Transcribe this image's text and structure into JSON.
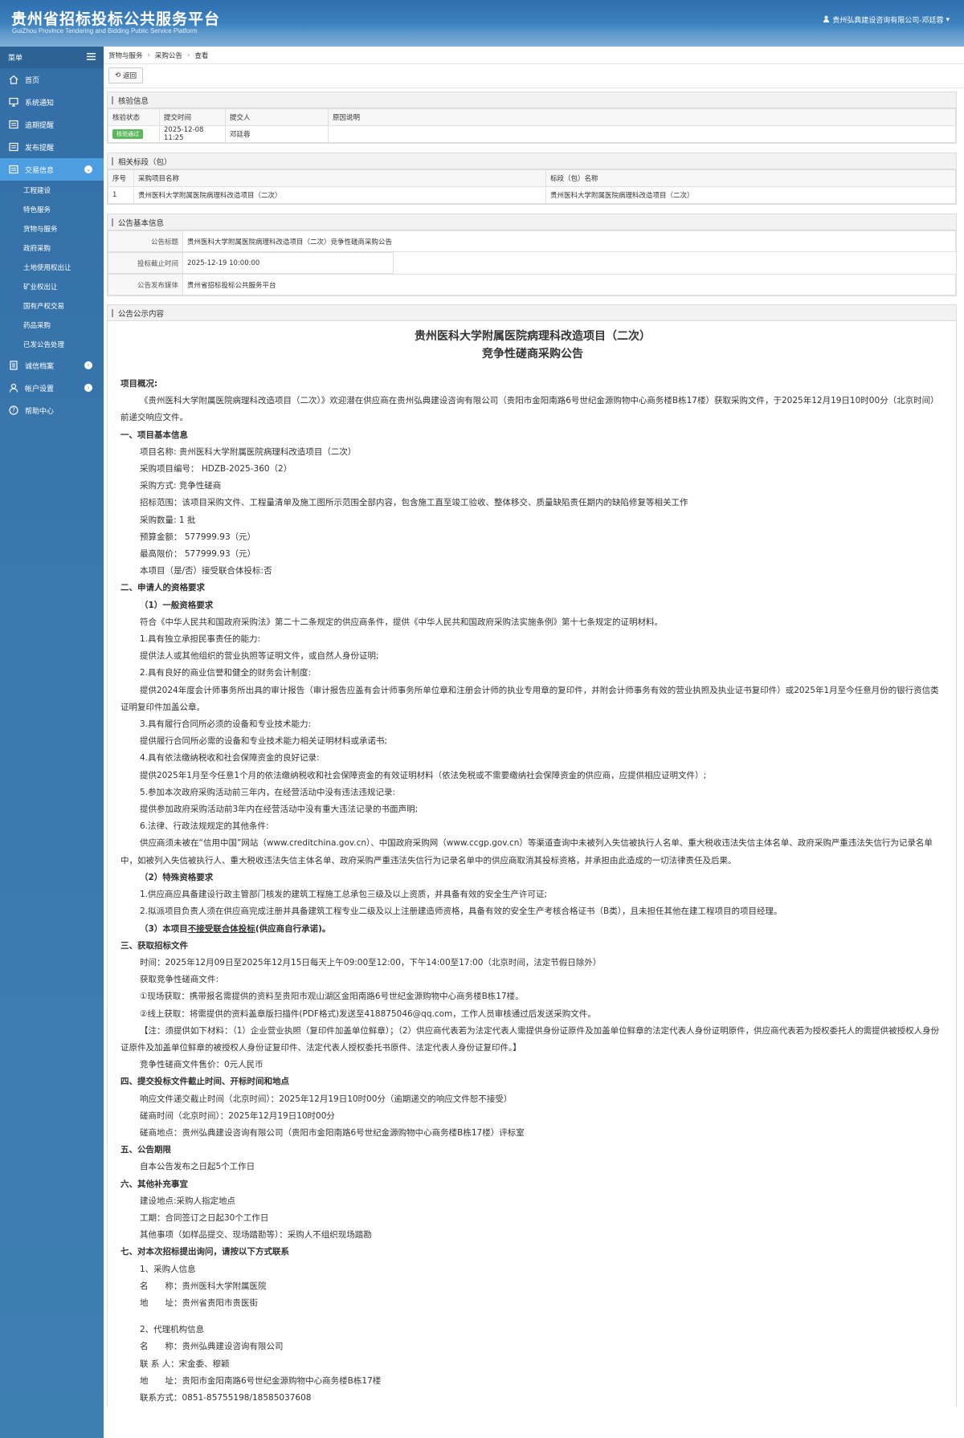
{
  "header": {
    "title": "贵州省招标投标公共服务平台",
    "subtitle": "GuiZhou Province Tendering and Bidding Public Service Platform",
    "user": "贵州弘典建设咨询有限公司-邓廷蓉"
  },
  "sidebar": {
    "menu_label": "菜单",
    "items": [
      {
        "label": "首页"
      },
      {
        "label": "系统通知"
      },
      {
        "label": "追期提醒"
      },
      {
        "label": "发布提醒"
      },
      {
        "label": "交易信息"
      },
      {
        "label": "诚信档案"
      },
      {
        "label": "帐户设置"
      },
      {
        "label": "帮助中心"
      }
    ],
    "sub_items": [
      "工程建设",
      "特色服务",
      "货物与服务",
      "政府采购",
      "土地使用权出让",
      "矿业权出让",
      "国有产权交易",
      "药品采购",
      "已发公告处理"
    ]
  },
  "breadcrumb": [
    "货物与服务",
    "采购公告",
    "查看"
  ],
  "toolbar": {
    "back": "返回"
  },
  "verify": {
    "title": "核验信息",
    "headers": [
      "核验状态",
      "提交时间",
      "提交人",
      "原因说明"
    ],
    "row": {
      "status": "核验通过",
      "time": "2025-12-08 11:25",
      "person": "邓廷蓉",
      "reason": ""
    }
  },
  "sections": {
    "title": "相关标段（包）",
    "headers": [
      "序号",
      "采购项目名称",
      "标段（包）名称"
    ],
    "row": {
      "no": "1",
      "project": "贵州医科大学附属医院病理科改造项目（二次）",
      "lot": "贵州医科大学附属医院病理科改造项目（二次）"
    }
  },
  "basic": {
    "title": "公告基本信息",
    "rows": [
      {
        "label": "公告标题",
        "value": "贵州医科大学附属医院病理科改造项目（二次）竞争性磋商采购公告"
      },
      {
        "label": "投标截止时间",
        "value": "2025-12-19 10:00:00"
      },
      {
        "label": "公告发布媒体",
        "value": "贵州省招标投标公共服务平台"
      }
    ]
  },
  "content": {
    "title": "公告公示内容",
    "heading1": "贵州医科大学附属医院病理科改造项目（二次）",
    "heading2": "竞争性磋商采购公告",
    "lines": [
      "项目概况:",
      "《贵州医科大学附属医院病理科改造项目（二次）》欢迎潜在供应商在贵州弘典建设咨询有限公司（贵阳市金阳南路6号世纪金源购物中心商务楼B栋17楼）获取采购文件，于2025年12月19日10时00分（北京时间）前递交响应文件。",
      "一、项目基本信息",
      "项目名称: 贵州医科大学附属医院病理科改造项目（二次）",
      "采购项目编号： HDZB-2025-360（2）",
      "采购方式: 竞争性磋商",
      "招标范围：该项目采购文件、工程量清单及施工图所示范围全部内容，包含施工直至竣工验收、整体移交、质量缺陷责任期内的缺陷修复等相关工作",
      "采购数量: 1 批",
      "预算金额： 577999.93（元）",
      "最高限价： 577999.93（元）",
      "本项目（是/否）接受联合体投标:否",
      "二、申请人的资格要求",
      "（1）一般资格要求",
      "符合《中华人民共和国政府采购法》第二十二条规定的供应商条件，提供《中华人民共和国政府采购法实施条例》第十七条规定的证明材料。",
      "1.具有独立承担民事责任的能力:",
      "提供法人或其他组织的营业执照等证明文件，或自然人身份证明;",
      "2.具有良好的商业信誉和健全的财务会计制度:",
      "提供2024年度会计师事务所出具的审计报告（审计报告应盖有会计师事务所单位章和注册会计师的执业专用章的复印件，并附会计师事务有效的营业执照及执业证书复印件）或2025年1月至今任意月份的银行资信类证明复印件加盖公章。",
      "3.具有履行合同所必须的设备和专业技术能力:",
      "提供履行合同所必需的设备和专业技术能力相关证明材料或承诺书;",
      "4.具有依法缴纳税收和社会保障资金的良好记录:",
      "提供2025年1月至今任意1个月的依法缴纳税收和社会保障资金的有效证明材料（依法免税或不需要缴纳社会保障资金的供应商，应提供相应证明文件）;",
      "5.参加本次政府采购活动前三年内，在经营活动中没有违法违规记录:",
      "提供参加政府采购活动前3年内在经营活动中没有重大违法记录的书面声明;",
      "6.法律、行政法规规定的其他条件:",
      "供应商须未被在“信用中国”网站（www.creditchina.gov.cn）、中国政府采购网（www.ccgp.gov.cn）等渠道查询中未被列入失信被执行人名单、重大税收违法失信主体名单、政府采购严重违法失信行为记录名单中，如被列入失信被执行人、重大税收违法失信主体名单、政府采购严重违法失信行为记录名单中的供应商取消其投标资格，并承担由此造成的一切法律责任及后果。",
      "（2）特殊资格要求",
      "1.供应商应具备建设行政主管部门核发的建筑工程施工总承包三级及以上资质，并具备有效的安全生产许可证;",
      "2.拟派项目负责人须在供应商完成注册并具备建筑工程专业二级及以上注册建造师资格，具备有效的安全生产考核合格证书（B类），且未担任其他在建工程项目的项目经理。",
      "（3）本项目",
      "不接受联合体投标",
      "(供应商自行承诺)。",
      "三、获取招标文件",
      "时间：2025年12月09日至2025年12月15日每天上午09:00至12:00，下午14:00至17:00（北京时间，法定节假日除外）",
      "获取竞争性磋商文件:",
      "①现场获取：携带报名需提供的资料至贵阳市观山湖区金阳南路6号世纪金源购物中心商务楼B栋17楼。",
      "②线上获取：将需提供的资料盖章版扫描件(PDF格式)发送至418875046@qq.com，工作人员审核通过后发送采购文件。",
      "【注：须提供如下材料：（1）企业营业执照（复印件加盖单位鲜章）；（2）供应商代表若为法定代表人需提供身份证原件及加盖单位鲜章的法定代表人身份证明原件，供应商代表若为授权委托人的需提供被授权人身份证原件及加盖单位鲜章的被授权人身份证复印件、法定代表人授权委托书原件、法定代表人身份证复印件。】",
      "竞争性磋商文件售价：0元人民币",
      "四、提交投标文件截止时间、开标时间和地点",
      "响应文件递交截止时间（北京时间）：2025年12月19日10时00分（逾期递交的响应文件恕不接受）",
      "磋商时间（北京时间）：2025年12月19日10时00分",
      "磋商地点：贵州弘典建设咨询有限公司（贵阳市金阳南路6号世纪金源购物中心商务楼B栋17楼）评标室",
      "五、公告期限",
      "自本公告发布之日起5个工作日",
      "六、其他补充事宜",
      "建设地点:采购人指定地点",
      "工期：合同签订之日起30个工作日",
      "其他事项（如样品提交、现场踏勘等）：采购人不组织现场踏勘",
      "七、对本次招标提出询问，请按以下方式联系",
      "1、采购人信息",
      "名　　称：贵州医科大学附属医院",
      "地　　址：贵州省贵阳市贵医街",
      "2、代理机构信息",
      "名　　称：贵州弘典建设咨询有限公司",
      "联 系 人：宋金委、穆颖",
      "地　　址：贵阳市金阳南路6号世纪金源购物中心商务楼B栋17楼",
      "联系方式：0851-85755198/18585037608"
    ]
  }
}
